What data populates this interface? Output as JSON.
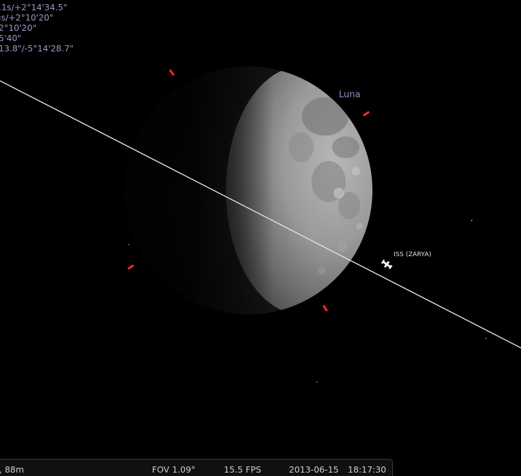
{
  "info_panel": {
    "lines": [
      ".1s/+2°14'34.5\"",
      "ıs/+2°10'20\"",
      "2°10'20\"",
      "5'40\"",
      "13.8\"/-5°14'28.7\""
    ]
  },
  "sky": {
    "target_label": "Luna",
    "satellite_label": "ISS (ZARYA)",
    "colors": {
      "background": "#000000",
      "marker": "#ff2a2a",
      "label": "#8f8fc8",
      "orbit_line": "#e6e6e6"
    }
  },
  "status_bar": {
    "location": ", 88m",
    "fov": "FOV 1.09°",
    "fps": "15.5 FPS",
    "date": "2013-06-15",
    "time": "18:17:30"
  }
}
